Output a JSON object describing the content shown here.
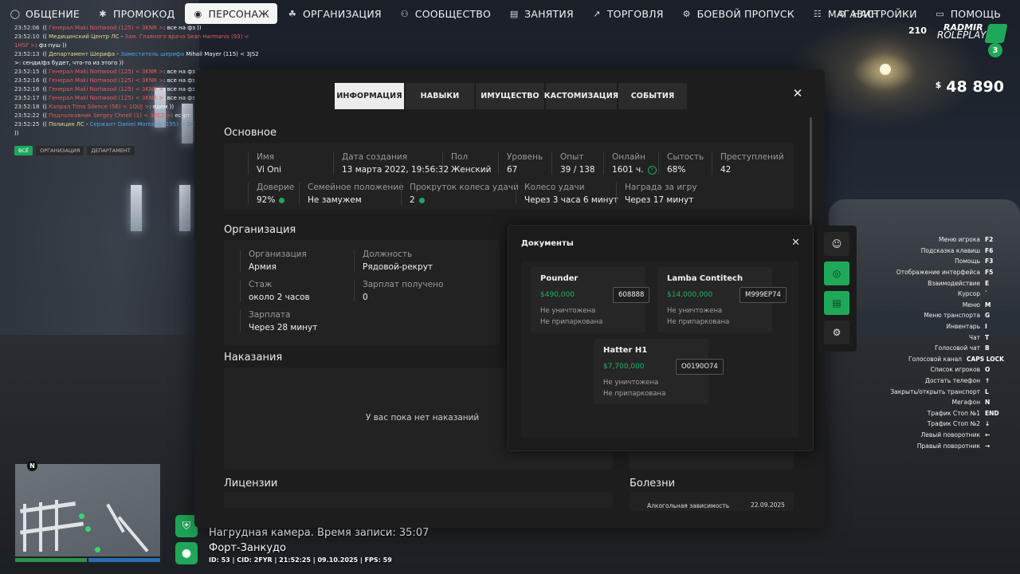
{
  "topnav": {
    "left": [
      {
        "icon": "chat-bubble-icon",
        "glyph": "◯",
        "label": "ОБЩЕНИЕ"
      },
      {
        "icon": "person-icon",
        "glyph": "✱",
        "label": "ПРОМОКОД"
      },
      {
        "icon": "user-circle-icon",
        "glyph": "◉",
        "label": "ПЕРСОНАЖ",
        "active": true
      },
      {
        "icon": "organization-icon",
        "glyph": "☘",
        "label": "ОРГАНИЗАЦИЯ"
      },
      {
        "icon": "community-icon",
        "glyph": "⚇",
        "label": "СООБЩЕСТВО"
      },
      {
        "icon": "book-icon",
        "glyph": "▤",
        "label": "ЗАНЯТИЯ"
      },
      {
        "icon": "chart-icon",
        "glyph": "↗",
        "label": "ТОРГОВЛЯ"
      },
      {
        "icon": "gear-star-icon",
        "glyph": "⚙",
        "label": "БОЕВОЙ ПРОПУСК"
      },
      {
        "icon": "cart-icon",
        "glyph": "☷",
        "label": "МАГАЗИН"
      }
    ],
    "right": [
      {
        "icon": "settings-icon",
        "glyph": "⚙",
        "label": "НАСТРОЙКИ"
      },
      {
        "icon": "help-chat-icon",
        "glyph": "▭",
        "label": "ПОМОЩЬ"
      }
    ]
  },
  "logo": {
    "online": "210",
    "brand1": "RADMIR",
    "brand2": "ROLEPLAY",
    "server": "3"
  },
  "money": {
    "currency": "$",
    "amount": "48 890"
  },
  "chat": {
    "lines": [
      {
        "t": "23:52:06",
        "segs": [
          {
            "c": "white",
            "x": "(( "
          },
          {
            "c": "red",
            "x": "Генерал Maki Nortwood (125) < 3KNR >"
          },
          {
            "c": "white",
            "x": ": все на фз ))"
          }
        ]
      },
      {
        "t": "23:52:10",
        "segs": [
          {
            "c": "white",
            "x": "(( "
          },
          {
            "c": "yel",
            "x": "Медицинский Центр ЛС"
          },
          {
            "c": "white",
            "x": " - "
          },
          {
            "c": "red",
            "x": "Зам. Главного врача Sean Harmanis (93) <"
          }
        ]
      },
      {
        "t": "",
        "segs": [
          {
            "c": "red",
            "x": "1HSF >"
          },
          {
            "c": "white",
            "x": ": фз пуш ))"
          }
        ]
      },
      {
        "t": "23:52:13",
        "segs": [
          {
            "c": "white",
            "x": "(( "
          },
          {
            "c": "yel",
            "x": "Департамент Шерифа"
          },
          {
            "c": "white",
            "x": " - "
          },
          {
            "c": "blue",
            "x": "Заместитель шерифа"
          },
          {
            "c": "white",
            "x": " Mihail Mayer (115) < 3JS2"
          }
        ]
      },
      {
        "t": "",
        "segs": [
          {
            "c": "white",
            "x": ">: сенди/фз будет, что-то из этого ))"
          }
        ]
      },
      {
        "t": "23:52:15",
        "segs": [
          {
            "c": "white",
            "x": "(( "
          },
          {
            "c": "red",
            "x": "Генерал Maki Nortwood (125) < 3KNR >"
          },
          {
            "c": "white",
            "x": ": все на фз ))"
          }
        ]
      },
      {
        "t": "23:52:16",
        "segs": [
          {
            "c": "white",
            "x": "(( "
          },
          {
            "c": "red",
            "x": "Генерал Maki Nortwood (125) < 3KNR >"
          },
          {
            "c": "white",
            "x": ": все на фз"
          }
        ]
      },
      {
        "t": "23:52:16",
        "segs": [
          {
            "c": "white",
            "x": "(( "
          },
          {
            "c": "red",
            "x": "Генерал Maki Nortwood (125) < 3KNR >"
          },
          {
            "c": "white",
            "x": ": все на фз"
          }
        ]
      },
      {
        "t": "23:52:17",
        "segs": [
          {
            "c": "white",
            "x": "(( "
          },
          {
            "c": "red",
            "x": "Генерал Maki Nortwood (125) < 3KNR >"
          },
          {
            "c": "white",
            "x": ": все на фз"
          }
        ]
      },
      {
        "t": "23:52:18",
        "segs": [
          {
            "c": "white",
            "x": "(( "
          },
          {
            "c": "red",
            "x": "Капрал Tima Silence (56) < 1QUJ >"
          },
          {
            "c": "white",
            "x": ": едем ))"
          }
        ]
      },
      {
        "t": "23:52:22",
        "segs": [
          {
            "c": "white",
            "x": "(( "
          },
          {
            "c": "red",
            "x": "Подполковник Sergey Chnell (1) < 3RCZ >"
          },
          {
            "c": "white",
            "x": ": ес-рт"
          }
        ]
      },
      {
        "t": "23:52:25",
        "segs": [
          {
            "c": "white",
            "x": "(( "
          },
          {
            "c": "yel",
            "x": "Полиция ЛС"
          },
          {
            "c": "white",
            "x": " - "
          },
          {
            "c": "blue",
            "x": "Сержант Daniel Montana (195) < 2KI"
          }
        ]
      },
      {
        "t": "",
        "segs": [
          {
            "c": "white",
            "x": "))"
          }
        ]
      }
    ],
    "tabs": [
      {
        "label": "ВСЁ",
        "active": true
      },
      {
        "label": "ОРГАНИЗАЦИЯ"
      },
      {
        "label": "ДЕПАРТАМЕНТ"
      }
    ]
  },
  "hotkeys": [
    {
      "label": "Меню игрока",
      "key": "F2"
    },
    {
      "label": "Подсказка клавиш",
      "key": "F6"
    },
    {
      "label": "Помощь",
      "key": "F3"
    },
    {
      "label": "Отображение интерфейса",
      "key": "F5"
    },
    {
      "label": "Взаимодействие",
      "key": "E"
    },
    {
      "label": "Курсор",
      "key": "`"
    },
    {
      "label": "Меню",
      "key": "M"
    },
    {
      "label": "Меню транспорта",
      "key": "G"
    },
    {
      "label": "Инвентарь",
      "key": "I"
    },
    {
      "label": "Чат",
      "key": "T"
    },
    {
      "label": "Голосовой чат",
      "key": "B"
    },
    {
      "label": "Голосовой канал",
      "key": "CAPS LOCK"
    },
    {
      "label": "Список игроков",
      "key": "O"
    },
    {
      "label": "Достать телефон",
      "key": "↑"
    },
    {
      "label": "Закрыть/открыть транспорт",
      "key": "L"
    },
    {
      "label": "Мегафон",
      "key": "N"
    },
    {
      "label": "Трафик Стоп №1",
      "key": "END"
    },
    {
      "label": "Трафик Стоп №2",
      "key": "↓"
    },
    {
      "label": "Левый поворотник",
      "key": "←"
    },
    {
      "label": "Правый поворотник",
      "key": "→"
    }
  ],
  "minimap": {
    "north": "N"
  },
  "hud": {
    "camera": "Нагрудная камера. Время записи: 35:07",
    "location": "Форт-Занкудо",
    "ids": "ID: 53 | CID: 2FYR | 21:52:25 | 09.10.2025 | FPS: 59"
  },
  "panel": {
    "tabs": [
      {
        "label": "ИНФОРМАЦИЯ",
        "active": true
      },
      {
        "label": "НАВЫКИ"
      },
      {
        "label": "ИМУЩЕСТВО"
      },
      {
        "label": "КАСТОМИЗАЦИЯ"
      },
      {
        "label": "СОБЫТИЯ"
      }
    ],
    "close": "✕",
    "basic": {
      "title": "Основное",
      "row1": [
        {
          "label": "Имя",
          "value": "Vi Oni"
        },
        {
          "label": "Дата создания",
          "value": "13 марта 2022, 19:56:32"
        },
        {
          "label": "Пол",
          "value": "Женский"
        },
        {
          "label": "Уровень",
          "value": "67"
        },
        {
          "label": "Опыт",
          "value": "39 / 138"
        },
        {
          "label": "Онлайн",
          "value": "1601 ч.",
          "badge": "question"
        },
        {
          "label": "Сытость",
          "value": "68%"
        },
        {
          "label": "Преступлений",
          "value": "42"
        }
      ],
      "row2": [
        {
          "label": "Доверие",
          "value": "92%",
          "badge": "dot"
        },
        {
          "label": "Семейное положение",
          "value": "Не замужем"
        },
        {
          "label": "Прокруток колеса удачи",
          "value": "2",
          "badge": "dot"
        },
        {
          "label": "Колесо удачи",
          "value": "Через 3 часа 6 минут"
        },
        {
          "label": "Награда за игру",
          "value": "Через 17 минут"
        }
      ]
    },
    "org": {
      "title": "Организация",
      "fields": [
        {
          "label": "Организация",
          "value": "Армия"
        },
        {
          "label": "Должность",
          "value": "Рядовой-рекрут"
        },
        {
          "label": "Стаж",
          "value": "около 2 часов"
        },
        {
          "label": "Зарплат получено",
          "value": "0"
        },
        {
          "label": "Зарплата",
          "value": "Через 28 минут"
        }
      ]
    },
    "punish": {
      "title": "Наказания",
      "empty": "У вас пока нет наказаний"
    },
    "licenses": {
      "title": "Лицензии"
    },
    "diseases": {
      "title": "Болезни",
      "rows": [
        {
          "name": "Алкогольная зависимость",
          "date": "22.09.2025"
        }
      ]
    }
  },
  "documents": {
    "title": "Документы",
    "close": "✕",
    "vehicles": [
      {
        "name": "Pounder",
        "price": "$490,000",
        "plate": "608888",
        "s1": "Не уничтожена",
        "s2": "Не припаркована"
      },
      {
        "name": "Lamba Contitech",
        "price": "$14,000,000",
        "plate": "M999EP74",
        "s1": "Не уничтожена",
        "s2": "Не припаркована"
      },
      {
        "name": "Hatter H1",
        "price": "$7,700,000",
        "plate": "O0190O74",
        "s1": "Не уничтожена",
        "s2": "Не припаркована"
      }
    ]
  },
  "sidebar_buttons": [
    {
      "icon": "user-icon",
      "glyph": "☺"
    },
    {
      "icon": "steering-wheel-icon",
      "glyph": "◎",
      "green": true
    },
    {
      "icon": "vehicle-document-icon",
      "glyph": "▤",
      "green": true
    },
    {
      "icon": "search-gear-icon",
      "glyph": "⚙"
    }
  ],
  "colors": {
    "accent": "#1fa85a",
    "price": "#1fb25f",
    "panel": "#1d1d1d"
  }
}
